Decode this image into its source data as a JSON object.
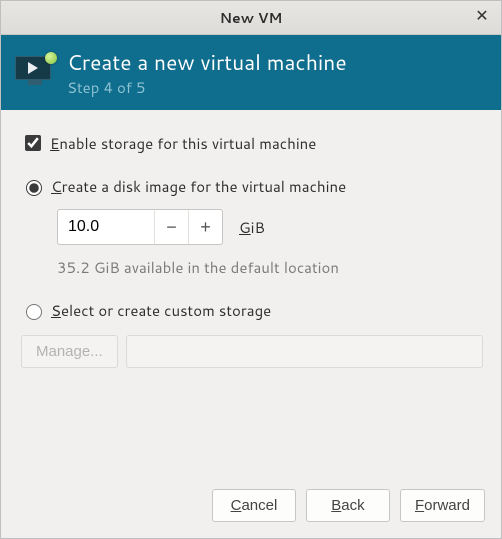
{
  "window": {
    "title": "New VM"
  },
  "banner": {
    "heading": "Create a new virtual machine",
    "step": "Step 4 of 5"
  },
  "storage": {
    "enable_label": "Enable storage for this virtual machine",
    "enable_checked": true,
    "create_disk_label": "Create a disk image for the virtual machine",
    "create_disk_selected": true,
    "size_value": "10.0",
    "size_unit": "GiB",
    "available_text": "35.2 GiB available in the default location",
    "custom_label": "Select or create custom storage",
    "custom_selected": false,
    "manage_label": "Manage...",
    "custom_path": ""
  },
  "buttons": {
    "cancel": "Cancel",
    "back": "Back",
    "forward": "Forward"
  }
}
